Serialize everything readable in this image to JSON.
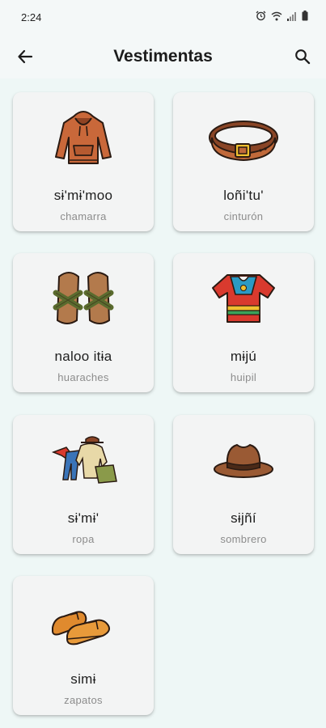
{
  "status_bar": {
    "time": "2:24"
  },
  "app_bar": {
    "title": "Vestimentas"
  },
  "items": [
    {
      "word": "sɨ'mɨ'moo",
      "translation": "chamarra",
      "icon": "hoodie-icon"
    },
    {
      "word": "loñi'tu'",
      "translation": "cinturón",
      "icon": "belt-icon"
    },
    {
      "word": "naloo itɨa",
      "translation": "huaraches",
      "icon": "sandals-icon"
    },
    {
      "word": "mɨjú",
      "translation": "huipil",
      "icon": "huipil-icon"
    },
    {
      "word": "sɨ'mɨ'",
      "translation": "ropa",
      "icon": "clothes-pile-icon"
    },
    {
      "word": "sɨjñí",
      "translation": "sombrero",
      "icon": "hat-icon"
    },
    {
      "word": "simɨ",
      "translation": "zapatos",
      "icon": "shoes-icon"
    }
  ],
  "colors": {
    "background": "#eef7f6",
    "card": "#f3f4f4",
    "brown": "#c0693a"
  }
}
